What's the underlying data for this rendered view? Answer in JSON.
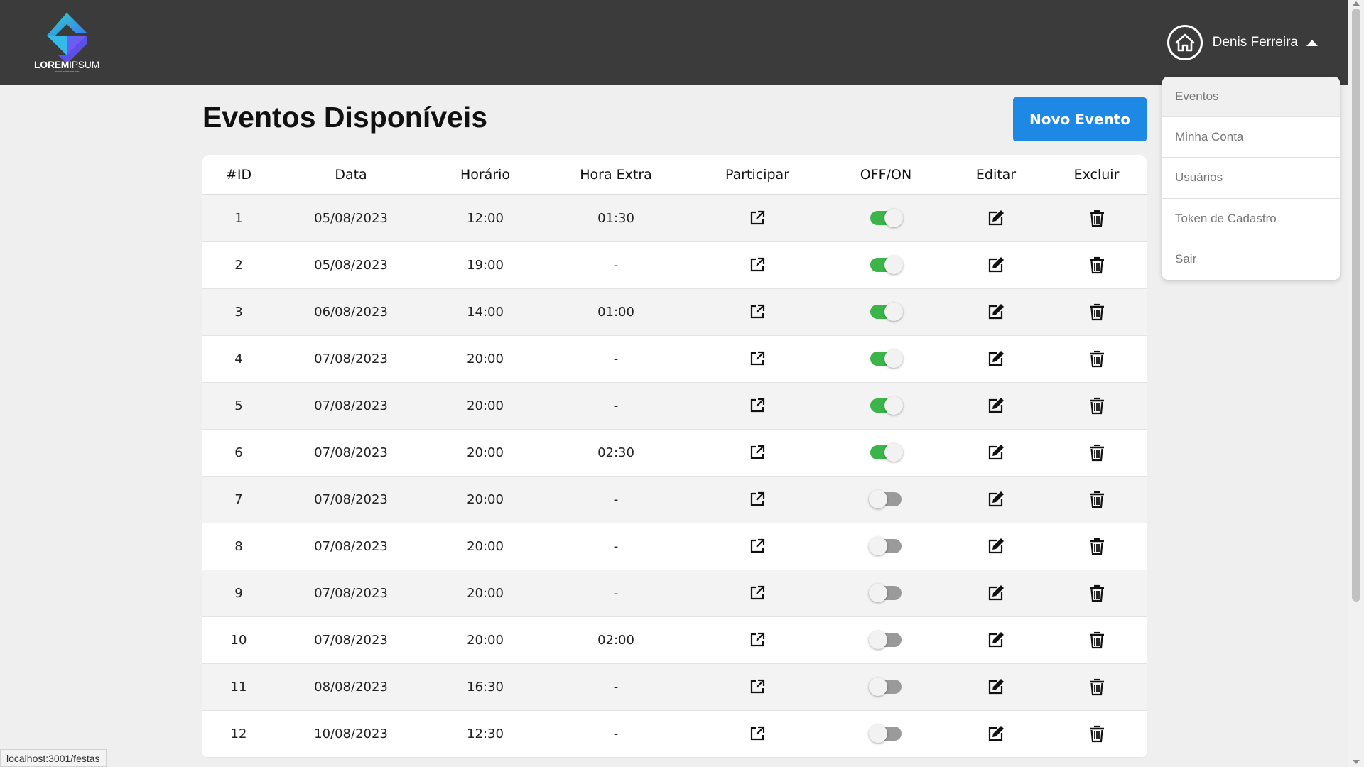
{
  "header": {
    "logo_text_bold": "LOREM",
    "logo_text_light": "IPSUM",
    "user_name": "Denis Ferreira"
  },
  "dropdown": {
    "items": [
      {
        "label": "Eventos",
        "active": true
      },
      {
        "label": "Minha Conta",
        "active": false
      },
      {
        "label": "Usuários",
        "active": false
      },
      {
        "label": "Token de Cadastro",
        "active": false
      },
      {
        "label": "Sair",
        "active": false
      }
    ]
  },
  "main": {
    "title": "Eventos Disponíveis",
    "new_button_label": "Novo Evento"
  },
  "table": {
    "columns": [
      "#ID",
      "Data",
      "Horário",
      "Hora Extra",
      "Participar",
      "OFF/ON",
      "Editar",
      "Excluir"
    ],
    "rows": [
      {
        "id": "1",
        "data": "05/08/2023",
        "horario": "12:00",
        "hora_extra": "01:30",
        "on": true
      },
      {
        "id": "2",
        "data": "05/08/2023",
        "horario": "19:00",
        "hora_extra": "-",
        "on": true
      },
      {
        "id": "3",
        "data": "06/08/2023",
        "horario": "14:00",
        "hora_extra": "01:00",
        "on": true
      },
      {
        "id": "4",
        "data": "07/08/2023",
        "horario": "20:00",
        "hora_extra": "-",
        "on": true
      },
      {
        "id": "5",
        "data": "07/08/2023",
        "horario": "20:00",
        "hora_extra": "-",
        "on": true
      },
      {
        "id": "6",
        "data": "07/08/2023",
        "horario": "20:00",
        "hora_extra": "02:30",
        "on": true
      },
      {
        "id": "7",
        "data": "07/08/2023",
        "horario": "20:00",
        "hora_extra": "-",
        "on": false
      },
      {
        "id": "8",
        "data": "07/08/2023",
        "horario": "20:00",
        "hora_extra": "-",
        "on": false
      },
      {
        "id": "9",
        "data": "07/08/2023",
        "horario": "20:00",
        "hora_extra": "-",
        "on": false
      },
      {
        "id": "10",
        "data": "07/08/2023",
        "horario": "20:00",
        "hora_extra": "02:00",
        "on": false
      },
      {
        "id": "11",
        "data": "08/08/2023",
        "horario": "16:30",
        "hora_extra": "-",
        "on": false
      },
      {
        "id": "12",
        "data": "10/08/2023",
        "horario": "12:30",
        "hora_extra": "-",
        "on": false
      }
    ]
  },
  "status_bar": {
    "url": "localhost:3001/festas"
  },
  "colors": {
    "header_bg": "#3b3b3b",
    "accent": "#1e88e5",
    "toggle_on": "#3bb54a",
    "toggle_off": "#9a9a9a"
  },
  "icons": {
    "participar": "external-link-icon",
    "editar": "edit-icon",
    "excluir": "trash-icon",
    "home": "home-icon",
    "dropdown": "caret-up-icon"
  }
}
